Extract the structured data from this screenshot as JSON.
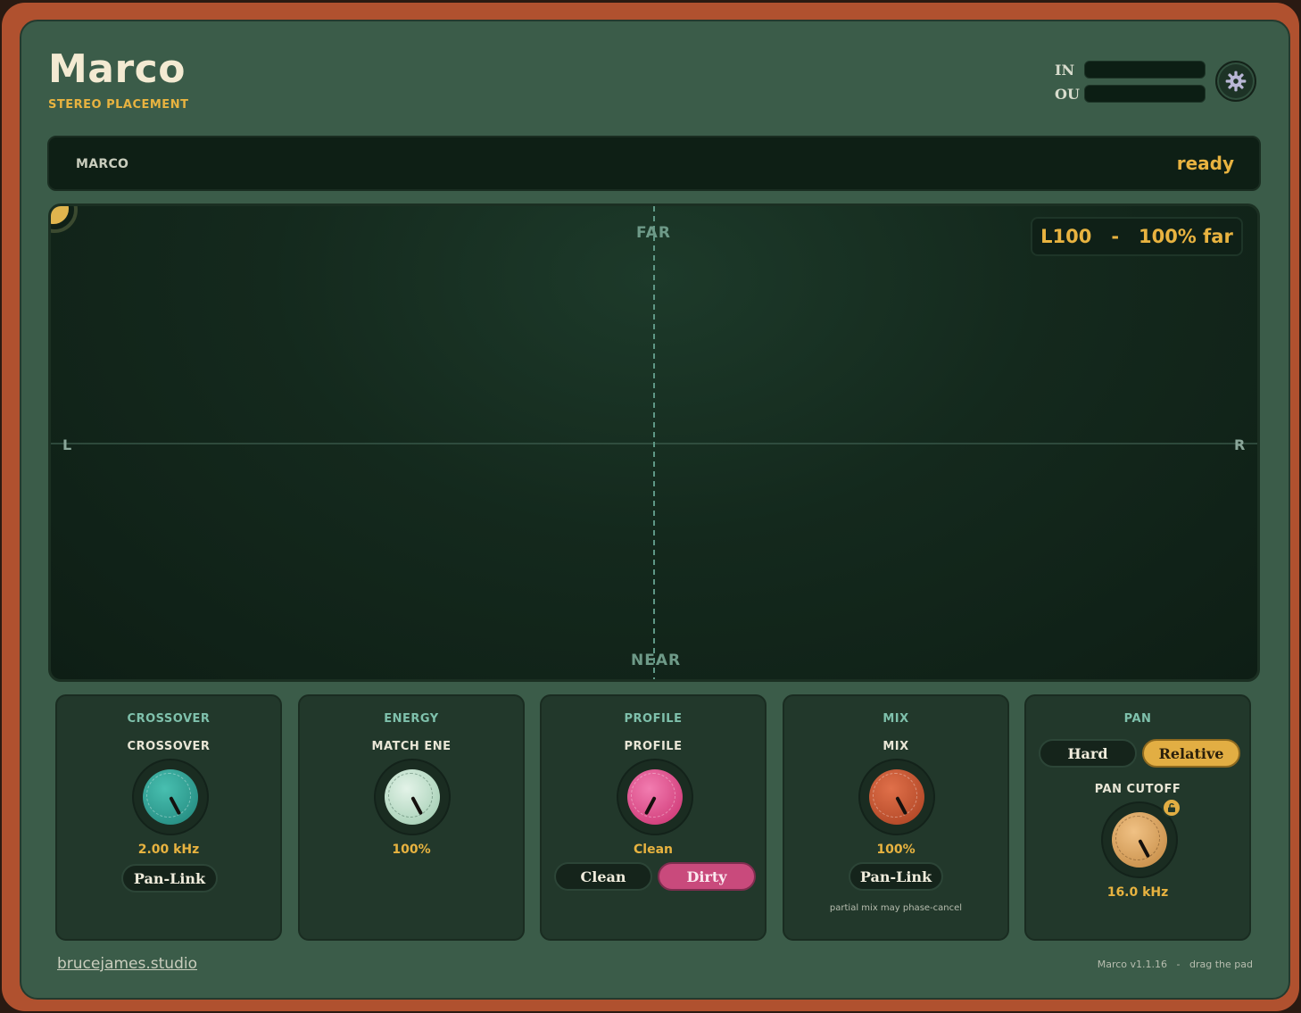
{
  "header": {
    "title": "Marco",
    "subtitle": "STEREO PLACEMENT",
    "meter_in_label": "IN",
    "meter_out_label": "OU"
  },
  "status": {
    "name": "MARCO",
    "state": "ready"
  },
  "pad": {
    "far_label": "FAR",
    "near_label": "NEAR",
    "left_label": "L",
    "right_label": "R",
    "readout_pan": "L100",
    "readout_sep": "-",
    "readout_depth": "100% far"
  },
  "panels": {
    "crossover": {
      "title": "CROSSOVER",
      "knob_label": "CROSSOVER",
      "value": "2.00 kHz",
      "button": "Pan-Link"
    },
    "energy": {
      "title": "ENERGY",
      "knob_label": "MATCH ENE",
      "value": "100%"
    },
    "profile": {
      "title": "PROFILE",
      "knob_label": "PROFILE",
      "value": "Clean",
      "option_clean": "Clean",
      "option_dirty": "Dirty"
    },
    "mix": {
      "title": "MIX",
      "knob_label": "MIX",
      "value": "100%",
      "button": "Pan-Link",
      "warning": "partial mix may phase-cancel"
    },
    "pan": {
      "title": "PAN",
      "option_hard": "Hard",
      "option_relative": "Relative",
      "knob_label": "PAN CUTOFF",
      "value": "16.0 kHz"
    }
  },
  "footer": {
    "link": "brucejames.studio",
    "version": "Marco v1.1.16",
    "sep": "-",
    "hint": "drag the pad"
  },
  "colors": {
    "frame": "#b0512f",
    "body": "#3b5c49",
    "accent": "#e8b340",
    "teal_knob": "#2a9a8f",
    "mint_knob": "#b8dcc6",
    "pink_knob": "#e0468a",
    "rust_knob": "#c95a33",
    "gold_knob": "#d59b50"
  }
}
